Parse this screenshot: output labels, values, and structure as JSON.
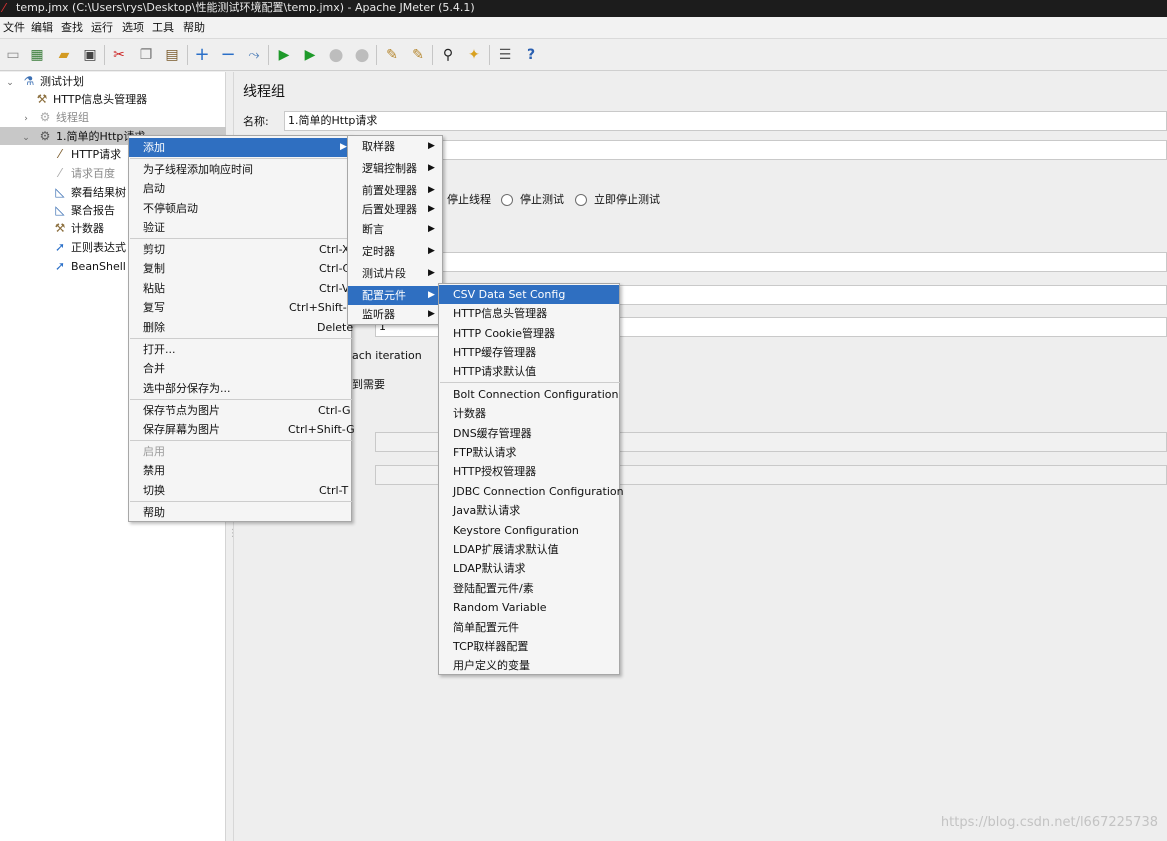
{
  "window": {
    "title": "temp.jmx (C:\\Users\\rys\\Desktop\\性能测试环境配置\\temp.jmx) - Apache JMeter (5.4.1)"
  },
  "menubar": [
    "文件",
    "编辑",
    "查找",
    "运行",
    "选项",
    "工具",
    "帮助"
  ],
  "toolbar": {
    "icons": [
      "new-icon",
      "templates-icon",
      "open-icon",
      "save-icon",
      "cut-icon",
      "copy-icon",
      "paste-icon",
      "expand-icon",
      "collapse-icon",
      "toggle-icon",
      "start-icon",
      "start-no-pause-icon",
      "stop-icon",
      "shutdown-icon",
      "clear-icon",
      "clear-all-icon",
      "search-icon",
      "reset-search-icon",
      "function-helper-icon",
      "help-icon"
    ]
  },
  "tree": {
    "root": "测试计划",
    "items": [
      "HTTP信息头管理器",
      "线程组",
      "1.简单的Http请求",
      "HTTP请求",
      "请求百度",
      "察看结果树",
      "聚合报告",
      "计数器",
      "正则表达式",
      "BeanShell 后"
    ]
  },
  "panel": {
    "title": "线程组",
    "name_label": "名称:",
    "name_value": "1.简单的Http请求",
    "actions": [
      "停止线程",
      "停止测试",
      "立即停止测试"
    ],
    "loop_value": "1",
    "each_iteration": "ach iteration",
    "delay_text": "到需要"
  },
  "context_menu": {
    "items": [
      {
        "label": "添加",
        "arrow": true,
        "highlight": true
      },
      {
        "label": "为子线程添加响应时间"
      },
      {
        "label": "启动"
      },
      {
        "label": "不停顿启动"
      },
      {
        "label": "验证"
      },
      {
        "label": "剪切",
        "shortcut": "Ctrl-X"
      },
      {
        "label": "复制",
        "shortcut": "Ctrl-C"
      },
      {
        "label": "粘贴",
        "shortcut": "Ctrl-V"
      },
      {
        "label": "复写",
        "shortcut": "Ctrl+Shift-C"
      },
      {
        "label": "删除",
        "shortcut": "Delete"
      },
      {
        "label": "打开..."
      },
      {
        "label": "合并"
      },
      {
        "label": "选中部分保存为..."
      },
      {
        "label": "保存节点为图片",
        "shortcut": "Ctrl-G"
      },
      {
        "label": "保存屏幕为图片",
        "shortcut": "Ctrl+Shift-G"
      },
      {
        "label": "启用",
        "disabled": true
      },
      {
        "label": "禁用"
      },
      {
        "label": "切换",
        "shortcut": "Ctrl-T"
      },
      {
        "label": "帮助"
      }
    ]
  },
  "add_submenu": {
    "items": [
      "取样器",
      "逻辑控制器",
      "前置处理器",
      "后置处理器",
      "断言",
      "定时器",
      "测试片段",
      "配置元件",
      "监听器"
    ],
    "highlighted": "配置元件"
  },
  "config_submenu": {
    "items": [
      "CSV Data Set Config",
      "HTTP信息头管理器",
      "HTTP Cookie管理器",
      "HTTP缓存管理器",
      "HTTP请求默认值",
      "Bolt Connection Configuration",
      "计数器",
      "DNS缓存管理器",
      "FTP默认请求",
      "HTTP授权管理器",
      "JDBC Connection Configuration",
      "Java默认请求",
      "Keystore Configuration",
      "LDAP扩展请求默认值",
      "LDAP默认请求",
      "登陆配置元件/素",
      "Random Variable",
      "简单配置元件",
      "TCP取样器配置",
      "用户定义的变量"
    ],
    "highlighted": "CSV Data Set Config"
  },
  "colors": {
    "highlight": "#2f6fc1",
    "title_bar": "#1c1c1c"
  },
  "watermark": "https://blog.csdn.net/l667225738"
}
